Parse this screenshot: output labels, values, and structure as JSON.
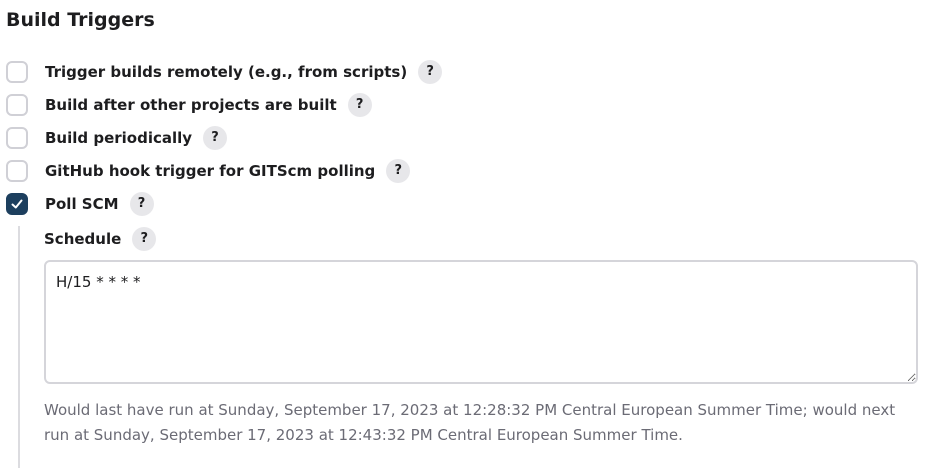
{
  "section": {
    "title": "Build Triggers"
  },
  "triggers": [
    {
      "label": "Trigger builds remotely (e.g., from scripts)",
      "checked": false,
      "help": "?"
    },
    {
      "label": "Build after other projects are built",
      "checked": false,
      "help": "?"
    },
    {
      "label": "Build periodically",
      "checked": false,
      "help": "?"
    },
    {
      "label": "GitHub hook trigger for GITScm polling",
      "checked": false,
      "help": "?"
    },
    {
      "label": "Poll SCM",
      "checked": true,
      "help": "?"
    }
  ],
  "poll_scm": {
    "schedule_label": "Schedule",
    "schedule_help": "?",
    "schedule_value": "H/15 * * * *",
    "hint": "Would last have run at Sunday, September 17, 2023 at 12:28:32 PM Central European Summer Time; would next run at Sunday, September 17, 2023 at 12:43:32 PM Central European Summer Time."
  },
  "colors": {
    "checkbox_checked": "#1d3f5e",
    "checkbox_border": "#d0d0d6",
    "help_bg": "#e7e7ea",
    "hint_text": "#6b6b75"
  },
  "icons": {
    "checkmark": "check-icon",
    "help": "question-mark-icon",
    "resize": "resize-grip-icon"
  }
}
